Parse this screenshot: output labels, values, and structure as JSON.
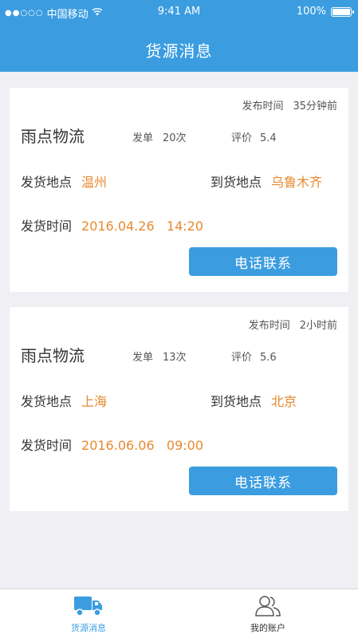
{
  "status_bar": {
    "signal_dots": "●●○○○",
    "carrier": "中国移动",
    "wifi_icon": "wifi-icon",
    "time": "9:41 AM",
    "battery": "100%"
  },
  "header": {
    "title": "货源消息"
  },
  "cards": [
    {
      "publish_label": "发布时间",
      "publish_time": "35分钟前",
      "company": "雨点物流",
      "orders_label": "发单",
      "orders_value": "20次",
      "rating_label": "评价",
      "rating_value": "5.4",
      "from_label": "发货地点",
      "from_value": "温州",
      "to_label": "到货地点",
      "to_value": "乌鲁木齐",
      "time_label": "发货时间",
      "time_value": "2016.04.26   14:20",
      "call_label": "电话联系"
    },
    {
      "publish_label": "发布时间",
      "publish_time": "2小时前",
      "company": "雨点物流",
      "orders_label": "发单",
      "orders_value": "13次",
      "rating_label": "评价",
      "rating_value": "5.6",
      "from_label": "发货地点",
      "from_value": "上海",
      "to_label": "到货地点",
      "to_value": "北京",
      "time_label": "发货时间",
      "time_value": "2016.06.06   09:00",
      "call_label": "电话联系"
    }
  ],
  "tabbar": {
    "tabs": [
      {
        "label": "货源消息",
        "icon": "truck-icon",
        "active": true
      },
      {
        "label": "我的账户",
        "icon": "users-icon",
        "active": false
      }
    ]
  },
  "colors": {
    "primary": "#3b9de0",
    "accent": "#e8892f",
    "background": "#efeff4"
  }
}
